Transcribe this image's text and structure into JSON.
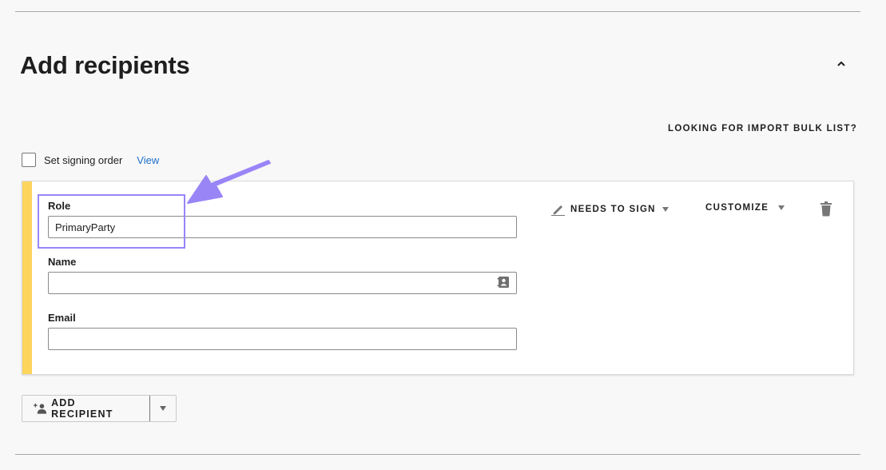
{
  "section": {
    "title": "Add recipients",
    "collapse_icon": "chevron-up-icon",
    "bulk_link": "LOOKING FOR IMPORT BULK LIST?"
  },
  "signing_order": {
    "label": "Set signing order",
    "checked": false,
    "view_link": "View"
  },
  "recipient": {
    "stripe_color": "#fdd45c",
    "role": {
      "label": "Role",
      "value": "PrimaryParty",
      "placeholder": ""
    },
    "name": {
      "label": "Name",
      "value": "",
      "placeholder": ""
    },
    "email": {
      "label": "Email",
      "value": "",
      "placeholder": ""
    },
    "action": {
      "label": "NEEDS TO SIGN",
      "icon": "pen-icon"
    },
    "customize": {
      "label": "CUSTOMIZE"
    },
    "delete_icon": "trash-icon"
  },
  "add_recipient": {
    "label": "ADD RECIPIENT",
    "icon": "add-person-icon"
  },
  "annotation": {
    "color": "#9a85f7"
  }
}
